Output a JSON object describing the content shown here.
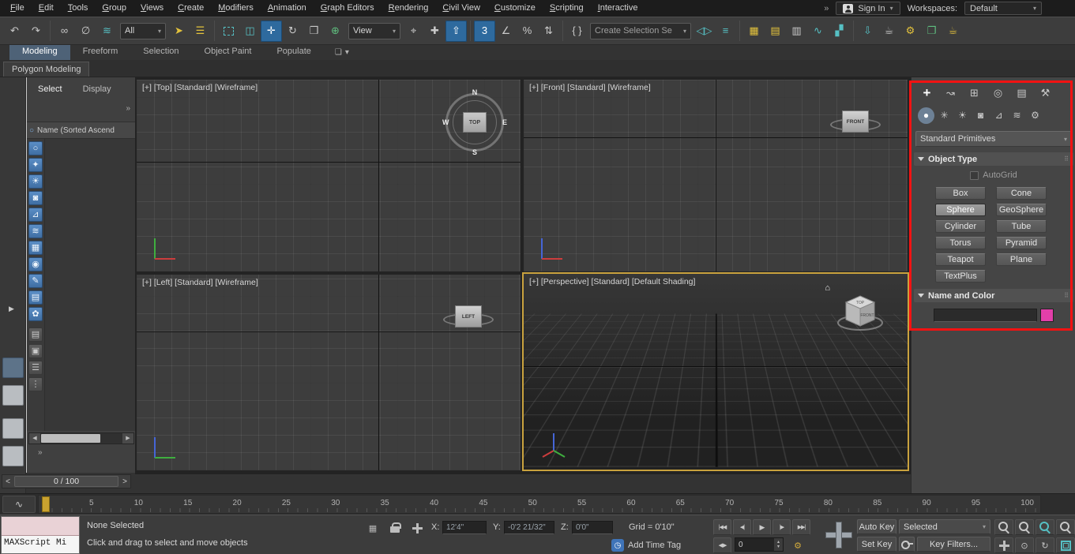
{
  "menu_bar": {
    "items": [
      "File",
      "Edit",
      "Tools",
      "Group",
      "Views",
      "Create",
      "Modifiers",
      "Animation",
      "Graph Editors",
      "Rendering",
      "Civil View",
      "Customize",
      "Scripting",
      "Interactive"
    ],
    "overflow": "»",
    "sign_in_label": "Sign In",
    "workspaces_label": "Workspaces:",
    "workspace_value": "Default"
  },
  "main_toolbar": {
    "selection_filter_value": "All",
    "reference_coordinate_value": "View",
    "named_selection_placeholder": "Create Selection Se",
    "snap_mode": "3"
  },
  "ribbon": {
    "tabs": [
      "Modeling",
      "Freeform",
      "Selection",
      "Object Paint",
      "Populate"
    ],
    "active_tab": "Modeling",
    "panel_tab": "Polygon Modeling"
  },
  "scene_explorer": {
    "tabs": [
      "Select",
      "Display"
    ],
    "active_tab": "Select",
    "column_header": "Name (Sorted Ascend",
    "overflow": "»"
  },
  "viewports": {
    "top": {
      "label": "[+] [Top] [Standard] [Wireframe]",
      "viewcube": {
        "center": "TOP",
        "n": "N",
        "s": "S",
        "e": "E",
        "w": "W"
      }
    },
    "front": {
      "label": "[+] [Front] [Standard] [Wireframe]",
      "viewcube": {
        "center": "FRONT"
      }
    },
    "left": {
      "label": "[+] [Left] [Standard] [Wireframe]",
      "viewcube": {
        "center": "LEFT"
      }
    },
    "perspective": {
      "label": "[+] [Perspective] [Standard] [Default Shading]",
      "viewcube": {
        "top": "TOP",
        "front": "FRONT"
      }
    }
  },
  "time_slider": {
    "value": "0 / 100"
  },
  "track_bar": {
    "tick_labels": [
      "5",
      "10",
      "15",
      "20",
      "25",
      "30",
      "35",
      "40",
      "45",
      "50",
      "55",
      "60",
      "65",
      "70",
      "75",
      "80",
      "85",
      "90",
      "95",
      "100"
    ],
    "current_frame": "0"
  },
  "command_panel": {
    "object_category_value": "Standard Primitives",
    "object_type_rollout": {
      "title": "Object Type",
      "autogrid_label": "AutoGrid",
      "buttons": [
        "Box",
        "Cone",
        "Sphere",
        "GeoSphere",
        "Cylinder",
        "Tube",
        "Torus",
        "Pyramid",
        "Teapot",
        "Plane",
        "TextPlus"
      ],
      "active_button": "Sphere"
    },
    "name_color_rollout": {
      "title": "Name and Color",
      "name_value": ""
    }
  },
  "status_bar": {
    "maxscript_value": "MAXScript Mi",
    "selection_status": "None Selected",
    "prompt_line": "Click and drag to select and move objects",
    "coord_x_label": "X:",
    "coord_x_value": "12'4\"",
    "coord_y_label": "Y:",
    "coord_y_value": "-0'2 21/32\"",
    "coord_z_label": "Z:",
    "coord_z_value": "0'0\"",
    "grid_text": "Grid = 0'10\"",
    "add_time_tag": "Add Time Tag",
    "frame_spinner_value": "0",
    "auto_key_label": "Auto Key",
    "set_key_label": "Set Key",
    "selected_dropdown_value": "Selected",
    "key_filters_label": "Key Filters..."
  },
  "icons": {
    "undo": "↶",
    "redo": "↷",
    "link": "∞",
    "unlink": "∅",
    "bind_to_space_warp": "≋",
    "select_object": "➤",
    "select_by_name": "☰",
    "window_crossing": "◫",
    "select_and_move": "✛",
    "select_and_rotate": "↻",
    "select_and_scale": "❒",
    "select_and_place": "⊕",
    "pivot_point_center": "⌖",
    "select_and_manipulate": "✚",
    "keyboard_shortcut_override": "⇧",
    "angle_snap": "∠",
    "percent_snap": "%",
    "spinner_snap": "⇅",
    "named_selection_sets": "{ }",
    "mirror": "◁▷",
    "align": "≡",
    "toggle_scene_explorer": "▦",
    "toggle_layer_explorer": "▤",
    "toggle_ribbon": "▥",
    "curve_editor": "∿",
    "schematic_view": "▞",
    "render_in_cloud": "⇩",
    "a360_gallery": "☕",
    "render_setup": "⚙",
    "rendered_frame_window": "❐",
    "render_production": "☕",
    "dropdown_arrow": "▾",
    "expander_arrow": "▶",
    "panel_create": "+",
    "panel_modify": "↝",
    "panel_hierarchy": "⊞",
    "panel_motion": "◎",
    "panel_display": "▤",
    "panel_utilities": "⚒",
    "cat_geometry": "●",
    "cat_shapes": "✳",
    "cat_lights": "☀",
    "cat_cameras": "◙",
    "cat_helpers": "⊿",
    "cat_space_warps": "≋",
    "cat_systems": "⚙",
    "rollout_grip": "⠿",
    "explorer_circle": "○",
    "explorer_filters": [
      "○",
      "✦",
      "☀",
      "◙",
      "⊿",
      "≋",
      "▦",
      "◉",
      "✎",
      "▤",
      "✿"
    ],
    "explorer_tools": [
      "▤",
      "▣",
      "☰",
      "⋮"
    ],
    "mini_curve_editor": "∿",
    "home": "⌂",
    "clock": "◷",
    "time_config_gear": "⚙",
    "grid_dots": "▦",
    "go_to_start": "|◀◀",
    "previous_frame": "◀|",
    "play": "▶",
    "next_frame": "|▶",
    "go_to_end": "▶▶|",
    "frame_step": "◀ ▶",
    "spinner_up": "▴",
    "spinner_down": "▾",
    "orbit": "↻",
    "walk_through": "⊙",
    "scroll_left": "◀",
    "scroll_right": "▶",
    "slider_prev": "<",
    "slider_next": ">",
    "ribbon_config_box": "❏"
  },
  "colors": {
    "active_tool_background": "#2e6a9e",
    "icon_teal": "#56c0c4",
    "icon_yellow": "#e3c23c",
    "active_viewport_border": "#c9a23e",
    "annotation": "#f31212",
    "name_color_swatch": "#e23fa9",
    "timeline_marker": "#c9a22f"
  }
}
